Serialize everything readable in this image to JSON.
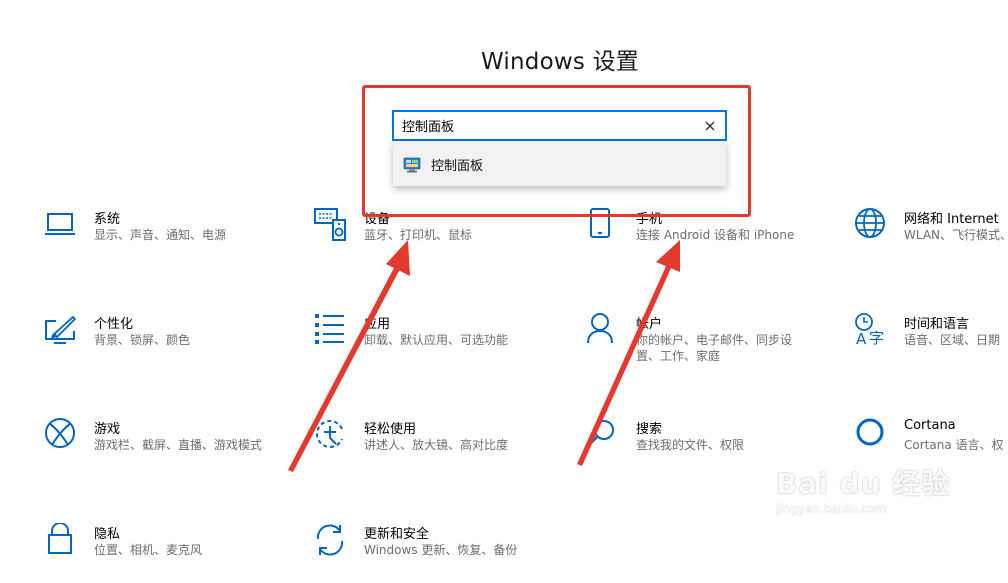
{
  "page": {
    "title": "Windows 设置"
  },
  "search": {
    "value": "控制面板",
    "suggestion": "控制面板"
  },
  "tiles": [
    {
      "name": "系统",
      "desc": "显示、声音、通知、电源",
      "icon": "laptop-icon"
    },
    {
      "name": "设备",
      "desc": "蓝牙、打印机、鼠标",
      "icon": "keyboard-speaker-icon"
    },
    {
      "name": "手机",
      "desc": "连接 Android 设备和 iPhone",
      "icon": "phone-icon"
    },
    {
      "name": "网络和 Internet",
      "desc": "WLAN、飞行模式、",
      "icon": "globe-icon"
    },
    {
      "name": "个性化",
      "desc": "背景、锁屏、颜色",
      "icon": "paint-monitor-icon"
    },
    {
      "name": "应用",
      "desc": "卸载、默认应用、可选功能",
      "icon": "app-list-icon"
    },
    {
      "name": "帐户",
      "desc": "你的帐户、电子邮件、同步设",
      "desc2": "置、工作、家庭",
      "icon": "person-icon"
    },
    {
      "name": "时间和语言",
      "desc": "语音、区域、日期",
      "icon": "time-language-icon"
    },
    {
      "name": "游戏",
      "desc": "游戏栏、截屏、直播、游戏模式",
      "icon": "xbox-icon"
    },
    {
      "name": "轻松使用",
      "desc": "讲述人、放大镜、高对比度",
      "icon": "ease-of-access-icon"
    },
    {
      "name": "搜索",
      "desc": "查找我的文件、权限",
      "icon": "search-icon"
    },
    {
      "name": "Cortana",
      "desc": "Cortana 语言、权",
      "icon": "cortana-icon"
    },
    {
      "name": "隐私",
      "desc": "位置、相机、麦克风",
      "icon": "lock-icon"
    },
    {
      "name": "更新和安全",
      "desc": "Windows 更新、恢复、备份",
      "icon": "update-icon"
    }
  ],
  "watermark": {
    "brand": "Bai du 经验",
    "url": "jingyan.baidu.com"
  },
  "colors": {
    "accent": "#0078d7",
    "annotation_red": "#e23a2e"
  }
}
